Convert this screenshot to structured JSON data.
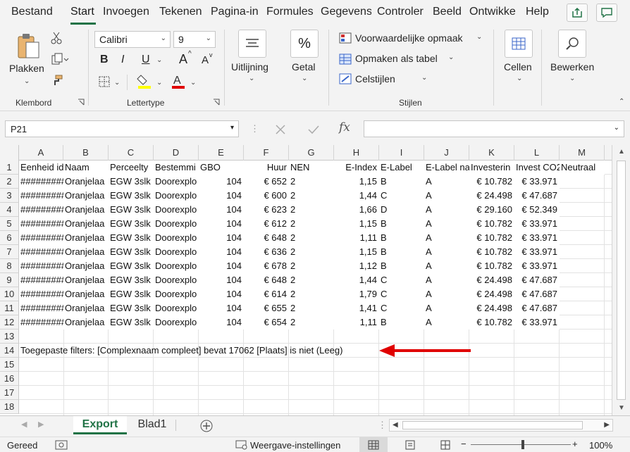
{
  "menu": {
    "tabs": [
      "Bestand",
      "Start",
      "Invoegen",
      "Tekenen",
      "Pagina-in",
      "Formules",
      "Gegevens",
      "Controler",
      "Beeld",
      "Ontwikke",
      "Help"
    ],
    "active": "Start"
  },
  "ribbon": {
    "clipboard": {
      "paste_label": "Plakken",
      "group_label": "Klembord"
    },
    "font": {
      "name": "Calibri",
      "size": "9",
      "group_label": "Lettertype",
      "bold": "B",
      "italic": "I",
      "underline": "U",
      "grow": "A",
      "shrink": "A",
      "fill_color": "#ffff00",
      "font_color": "#c00000"
    },
    "alignment": {
      "label": "Uitlijning"
    },
    "number": {
      "label": "Getal",
      "glyph": "%"
    },
    "styles": {
      "conditional": "Voorwaardelijke opmaak",
      "table": "Opmaken als tabel",
      "cell_styles": "Celstijlen",
      "group_label": "Stijlen"
    },
    "cells": {
      "label": "Cellen"
    },
    "editing": {
      "label": "Bewerken"
    }
  },
  "formula_bar": {
    "name_box": "P21",
    "fx": "fx",
    "value": ""
  },
  "grid": {
    "columns": [
      "A",
      "B",
      "C",
      "D",
      "E",
      "F",
      "G",
      "H",
      "I",
      "J",
      "K",
      "L",
      "M"
    ],
    "header_row": [
      "Eenheid id",
      "Naam",
      "Perceelty",
      "Bestemmi",
      "GBO",
      "Huur",
      "NEN",
      "E-Index",
      "E-Label",
      "E-Label na",
      "Investerin",
      "Invest CO2",
      "Neutraal"
    ],
    "rows": [
      [
        "#########",
        "Oranjelaa",
        "EGW 3slk",
        "Doorexplo",
        "104",
        "€ 652",
        "2",
        "1,15",
        "B",
        "A",
        "€ 10.782",
        "€ 33.971"
      ],
      [
        "#########",
        "Oranjelaa",
        "EGW 3slk",
        "Doorexplo",
        "104",
        "€ 600",
        "2",
        "1,44",
        "C",
        "A",
        "€ 24.498",
        "€ 47.687"
      ],
      [
        "#########",
        "Oranjelaa",
        "EGW 3slk",
        "Doorexplo",
        "104",
        "€ 623",
        "2",
        "1,66",
        "D",
        "A",
        "€ 29.160",
        "€ 52.349"
      ],
      [
        "#########",
        "Oranjelaa",
        "EGW 3slk",
        "Doorexplo",
        "104",
        "€ 612",
        "2",
        "1,15",
        "B",
        "A",
        "€ 10.782",
        "€ 33.971"
      ],
      [
        "#########",
        "Oranjelaa",
        "EGW 3slk",
        "Doorexplo",
        "104",
        "€ 648",
        "2",
        "1,11",
        "B",
        "A",
        "€ 10.782",
        "€ 33.971"
      ],
      [
        "#########",
        "Oranjelaa",
        "EGW 3slk",
        "Doorexplo",
        "104",
        "€ 636",
        "2",
        "1,15",
        "B",
        "A",
        "€ 10.782",
        "€ 33.971"
      ],
      [
        "#########",
        "Oranjelaa",
        "EGW 3slk",
        "Doorexplo",
        "104",
        "€ 678",
        "2",
        "1,12",
        "B",
        "A",
        "€ 10.782",
        "€ 33.971"
      ],
      [
        "#########",
        "Oranjelaa",
        "EGW 3slk",
        "Doorexplo",
        "104",
        "€ 648",
        "2",
        "1,44",
        "C",
        "A",
        "€ 24.498",
        "€ 47.687"
      ],
      [
        "#########",
        "Oranjelaa",
        "EGW 3slk",
        "Doorexplo",
        "104",
        "€ 614",
        "2",
        "1,79",
        "C",
        "A",
        "€ 24.498",
        "€ 47.687"
      ],
      [
        "#########",
        "Oranjelaa",
        "EGW 3slk",
        "Doorexplo",
        "104",
        "€ 655",
        "2",
        "1,41",
        "C",
        "A",
        "€ 24.498",
        "€ 47.687"
      ],
      [
        "#########",
        "Oranjelaa",
        "EGW 3slk",
        "Doorexplo",
        "104",
        "€ 654",
        "2",
        "1,11",
        "B",
        "A",
        "€ 10.782",
        "€ 33.971"
      ]
    ],
    "filter_note": "Toegepaste filters:  [Complexnaam compleet] bevat 17062 [Plaats] is niet (Leeg)",
    "row_numbers": [
      "1",
      "2",
      "3",
      "4",
      "5",
      "6",
      "7",
      "8",
      "9",
      "10",
      "11",
      "12",
      "13",
      "14",
      "15",
      "16",
      "17",
      "18"
    ],
    "arrow_color": "#e00000"
  },
  "sheets": {
    "tabs": [
      "Export",
      "Blad1"
    ],
    "active": "Export"
  },
  "status": {
    "ready": "Gereed",
    "display_settings": "Weergave-instellingen",
    "zoom": "100%"
  },
  "accent_color": "#217346"
}
